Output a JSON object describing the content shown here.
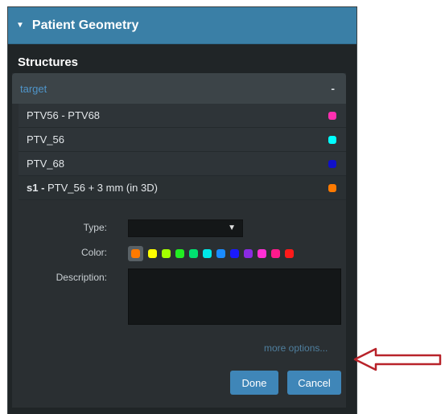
{
  "panel": {
    "title": "Patient Geometry"
  },
  "structures": {
    "title": "Structures",
    "group": {
      "name": "target",
      "collapse_symbol": "-",
      "items": [
        {
          "prefix": "",
          "name": "PTV56 - PTV68",
          "color": "#ff2fb0"
        },
        {
          "prefix": "",
          "name": "PTV_56",
          "color": "#00ffff"
        },
        {
          "prefix": "",
          "name": "PTV_68",
          "color": "#1010c8"
        },
        {
          "prefix": "s1 - ",
          "name": "PTV_56 + 3 mm (in 3D)",
          "color": "#ff7a00"
        }
      ]
    }
  },
  "editor": {
    "type_label": "Type:",
    "type_value": "",
    "color_label": "Color:",
    "selected_color": "#ff7a00",
    "palette": [
      "#ffff00",
      "#a4ff00",
      "#22ee22",
      "#00e070",
      "#00e8e8",
      "#1a8cff",
      "#1a1aff",
      "#8a2be2",
      "#ff2fd5",
      "#ff1a8c",
      "#ff1a1a"
    ],
    "description_label": "Description:",
    "description_value": "",
    "more_options": "more options...",
    "done_label": "Done",
    "cancel_label": "Cancel"
  },
  "colors": {
    "header": "#3a7fa6",
    "button": "#3f86b8",
    "annotation_arrow": "#b8232a"
  }
}
